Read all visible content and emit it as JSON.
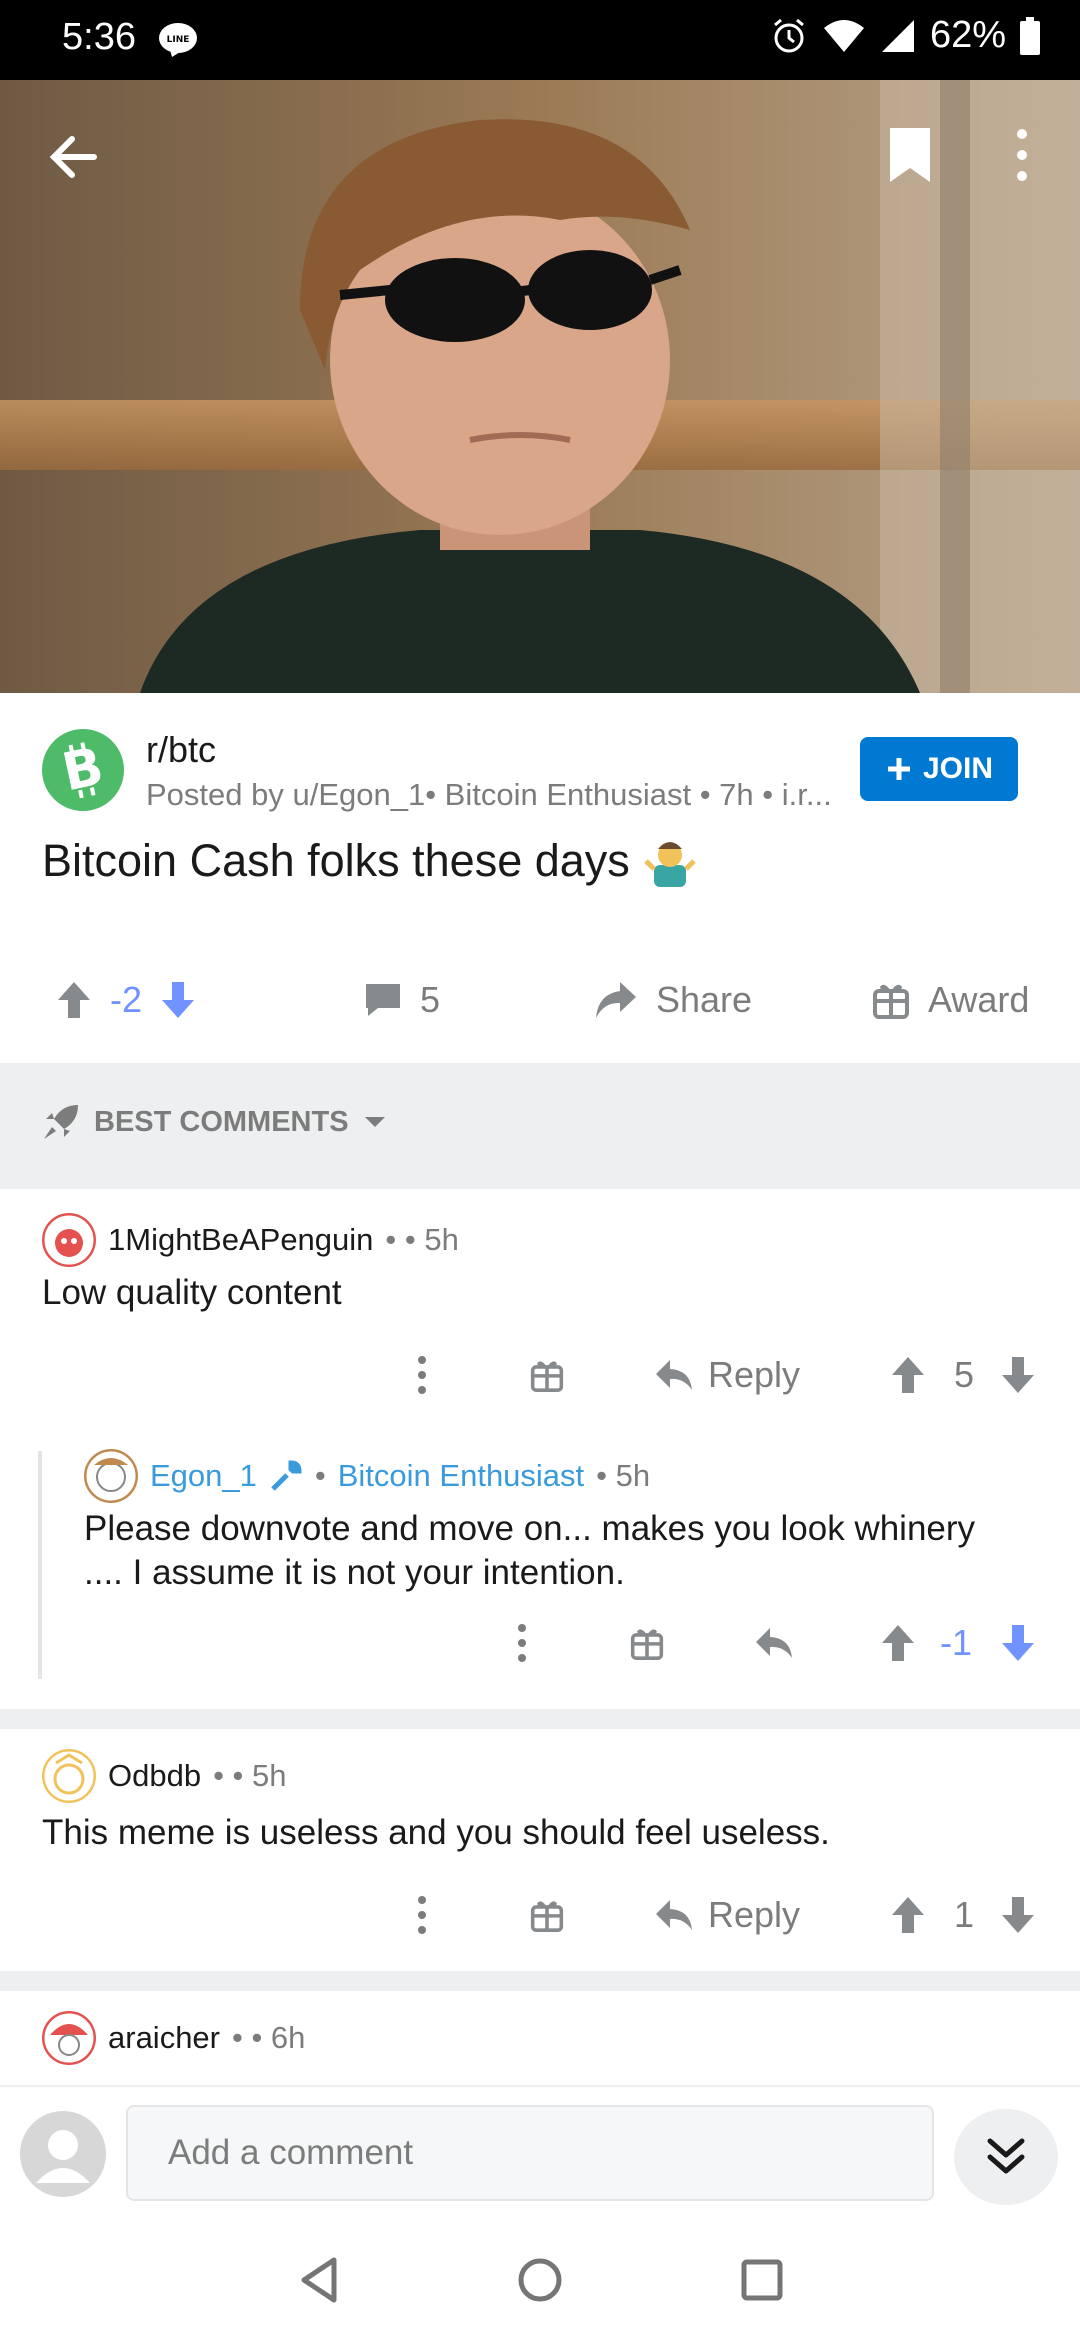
{
  "status_bar": {
    "time": "5:36",
    "battery": "62%"
  },
  "post": {
    "subreddit": "r/btc",
    "meta": "Posted by u/Egon_1• Bitcoin Enthusiast • 7h • i.r...",
    "join_label": "JOIN",
    "title": "Bitcoin Cash folks these days",
    "score": "-2",
    "comment_count": "5",
    "share_label": "Share",
    "award_label": "Award"
  },
  "sort": {
    "label": "BEST COMMENTS"
  },
  "comments": [
    {
      "author": "1MightBeAPenguin",
      "meta": "• • 5h",
      "body": "Low quality content",
      "reply_label": "Reply",
      "score": "5"
    },
    {
      "author": "Egon_1",
      "flair": "Bitcoin Enthusiast",
      "meta": "• 5h",
      "body": "Please downvote and move on... makes you look whinery .... I assume it is not your intention.",
      "score": "-1"
    },
    {
      "author": "Odbdb",
      "meta": "• • 5h",
      "body": "This meme is useless and you should feel useless.",
      "reply_label": "Reply",
      "score": "1"
    },
    {
      "author": "araicher",
      "meta": "• • 6h"
    }
  ],
  "composer": {
    "placeholder": "Add a comment"
  },
  "colors": {
    "accent": "#0079d3",
    "upvote_blue": "#7193ff",
    "subreddit_green": "#4dbb68"
  }
}
